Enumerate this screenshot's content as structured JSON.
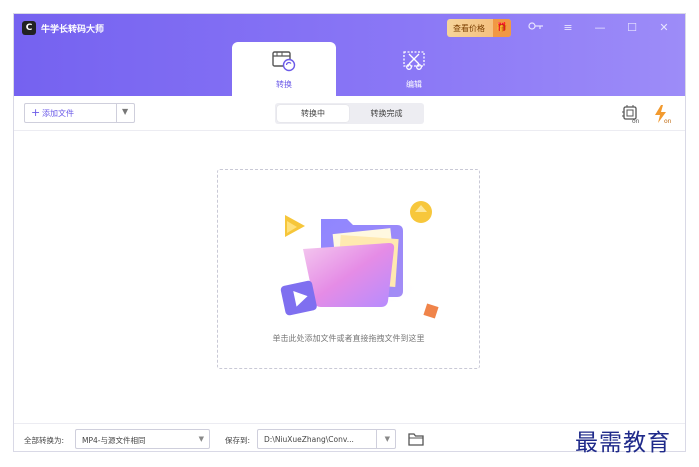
{
  "app": {
    "title": "牛学长转码大师"
  },
  "header": {
    "price_button": "查看价格",
    "tabs": [
      {
        "label": "转换",
        "icon": "video-convert-icon"
      },
      {
        "label": "编辑",
        "icon": "scissors-edit-icon"
      }
    ]
  },
  "toolbar": {
    "add_file": "添加文件",
    "segments": [
      "转换中",
      "转换完成"
    ]
  },
  "dropzone": {
    "hint": "单击此处添加文件或者直接拖拽文件到这里"
  },
  "footer": {
    "convert_all_label": "全部转换为:",
    "format_value": "MP4-与源文件相同",
    "save_label": "保存到:",
    "save_path": "D:\\NiuXueZhang\\Conv..."
  },
  "watermark": "最需教育",
  "colors": {
    "accent": "#6b5ae8",
    "header": "#7562f0",
    "price": "#f4b874"
  }
}
